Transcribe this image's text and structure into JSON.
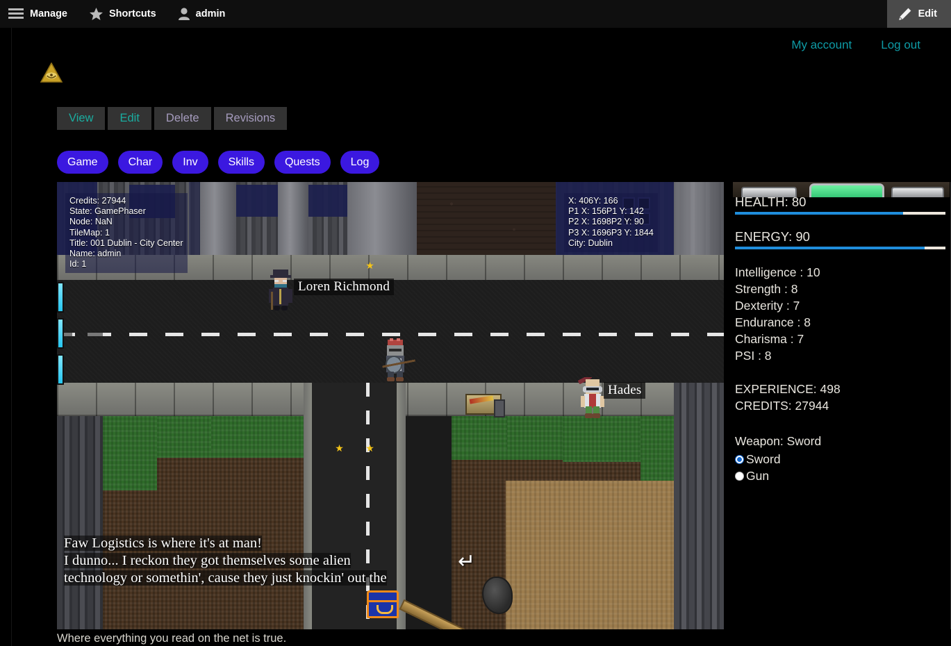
{
  "admin_bar": {
    "items": [
      {
        "label": "Manage",
        "icon": "hamburger-icon"
      },
      {
        "label": "Shortcuts",
        "icon": "star-icon"
      },
      {
        "label": "admin",
        "icon": "user-icon"
      }
    ],
    "edit": {
      "label": "Edit",
      "icon": "pencil-icon"
    }
  },
  "user_links": [
    {
      "label": "My account"
    },
    {
      "label": "Log out"
    }
  ],
  "site": {
    "logo_icon": "illuminati-pyramid-icon",
    "tagline": "Where everything you read on the net is true."
  },
  "task_tabs": [
    {
      "label": "View",
      "style": "teal",
      "active": true
    },
    {
      "label": "Edit",
      "style": "teal",
      "active": false
    },
    {
      "label": "Delete",
      "style": "mauve",
      "active": false
    },
    {
      "label": "Revisions",
      "style": "mauve",
      "active": false
    }
  ],
  "game_tabs": [
    {
      "label": "Game"
    },
    {
      "label": "Char"
    },
    {
      "label": "Inv"
    },
    {
      "label": "Skills"
    },
    {
      "label": "Quests"
    },
    {
      "label": "Log"
    }
  ],
  "hud_left": {
    "lines": [
      "Credits: 27944",
      "State: GamePhaser",
      "Node: NaN",
      "TileMap: 1",
      "Title: 001 Dublin - City Center",
      "Name: admin",
      "Id: 1"
    ]
  },
  "hud_right": {
    "lines": [
      "X: 406Y: 166",
      "P1 X: 156P1 Y: 142",
      "P2 X: 1698P2 Y: 90",
      "P3 X: 1696P3 Y: 1844",
      "City: Dublin"
    ]
  },
  "sprites": {
    "npc_name": "Loren Richmond",
    "enemy_name": "Hades"
  },
  "dialogue": {
    "line1": "Faw Logistics is where it's at man!",
    "line2": "I dunno... I reckon they got themselves some alien",
    "line3": "technology or somethin', cause they just knockin' out the",
    "continue_icon": "enter-arrow-icon"
  },
  "stats": {
    "health": {
      "label": "HEALTH: 80",
      "value": 80,
      "max": 100
    },
    "energy": {
      "label": "ENERGY: 90",
      "value": 90,
      "max": 100
    },
    "attributes": [
      {
        "label": "Intelligence : 10"
      },
      {
        "label": "Strength : 8"
      },
      {
        "label": "Dexterity : 7"
      },
      {
        "label": "Endurance : 8"
      },
      {
        "label": "Charisma : 7"
      },
      {
        "label": "PSI : 8"
      }
    ],
    "experience": "EXPERIENCE: 498",
    "credits": "CREDITS: 27944",
    "weapon_current": "Weapon: Sword",
    "weapon_options": [
      {
        "label": "Sword",
        "selected": true
      },
      {
        "label": "Gun",
        "selected": false
      }
    ]
  },
  "colors": {
    "accent_pill": "#3b18e0",
    "link_teal": "#0e9ba6",
    "tab_teal": "#1aada0",
    "tab_mauve": "#a59bbd",
    "bar_fill": "#1f8ddb",
    "bar_bg": "#ece6dc"
  }
}
